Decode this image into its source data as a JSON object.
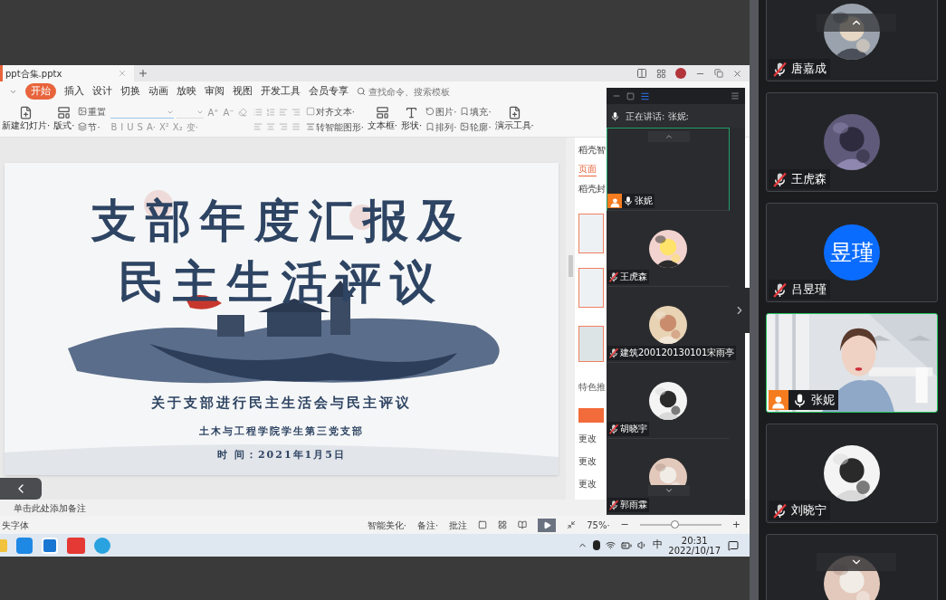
{
  "presentation": {
    "file_tab": "ppt合集.pptx",
    "menu": [
      {
        "label": "开始",
        "selected": true
      },
      {
        "label": "插入",
        "selected": false
      },
      {
        "label": "设计",
        "selected": false
      },
      {
        "label": "切换",
        "selected": false
      },
      {
        "label": "动画",
        "selected": false
      },
      {
        "label": "放映",
        "selected": false
      },
      {
        "label": "审阅",
        "selected": false
      },
      {
        "label": "视图",
        "selected": false
      },
      {
        "label": "开发工具",
        "selected": false
      },
      {
        "label": "会员专享",
        "selected": false
      }
    ],
    "search_placeholder": "查找命令、搜索模板",
    "toolbar": [
      {
        "kind": "large",
        "label": "新建幻灯片·"
      },
      {
        "kind": "large",
        "label": "版式·"
      },
      {
        "kind": "stack",
        "items": [
          "重置",
          "节·"
        ]
      },
      {
        "kind": "font",
        "items": [
          "A⁺",
          "A⁻"
        ],
        "keys": [
          "B",
          "I",
          "U",
          "S",
          "A·",
          "X²",
          "X₂",
          "变·"
        ]
      },
      {
        "kind": "paragraph"
      },
      {
        "kind": "stack",
        "items": [
          "对齐文本·",
          "转智能图形·"
        ]
      },
      {
        "kind": "large",
        "label": "文本框·"
      },
      {
        "kind": "large",
        "label": "形状·"
      },
      {
        "kind": "stack",
        "items": [
          "图片·",
          "排列·"
        ]
      },
      {
        "kind": "stack",
        "items": [
          "填充·",
          "轮廓·"
        ]
      },
      {
        "kind": "large",
        "label": "演示工具·"
      }
    ],
    "slide": {
      "title_lines": [
        "支部年度汇报及",
        "民主生活评议"
      ],
      "subtitle": "关于支部进行民主生活会与民主评议",
      "organization": "土木与工程学院学生第三党支部",
      "date": "时 间：2021年1月5日"
    },
    "side_panel": {
      "header": "稻壳智",
      "tab": "页面",
      "section": "稻壳封",
      "recommend": "特色推",
      "rows": [
        "更改",
        "更改",
        "更改"
      ]
    },
    "notes_placeholder": "单击此处添加备注",
    "status_left": "失字体",
    "status_items": [
      "智能美化·",
      "备注·",
      "批注"
    ],
    "zoom": "75%·",
    "zoom_slider": {
      "level": 0.42
    },
    "zoom_out": "−",
    "zoom_in": "+"
  },
  "taskbar": {
    "ime": "中",
    "time": "20:31",
    "date": "2022/10/17"
  },
  "meeting_panel": {
    "speaking_label": "正在讲话: 张妮:",
    "participants": [
      {
        "name": "张妮",
        "muted": false,
        "speaking": true,
        "host": true,
        "avatar": {
          "kind": "none"
        }
      },
      {
        "name": "王虎森",
        "muted": true,
        "speaking": false,
        "host": false
      },
      {
        "name": "建筑200120130101宋雨亭",
        "muted": true,
        "speaking": false,
        "host": false
      },
      {
        "name": "胡晓宇",
        "muted": true,
        "speaking": false,
        "host": false
      },
      {
        "name": "郭雨霖",
        "muted": true,
        "speaking": false,
        "host": false
      }
    ]
  },
  "gallery": [
    {
      "name": "唐嘉成",
      "muted": true,
      "speaking": false,
      "host": false
    },
    {
      "name": "王虎森",
      "muted": true,
      "speaking": false,
      "host": false
    },
    {
      "name": "吕昱瑾",
      "muted": true,
      "speaking": false,
      "host": false,
      "avatar": {
        "kind": "initials",
        "text": "昱瑾"
      }
    },
    {
      "name": "张妮",
      "muted": false,
      "speaking": true,
      "host": true,
      "avatar": {
        "kind": "video"
      }
    },
    {
      "name": "刘晓宁",
      "muted": true,
      "speaking": false,
      "host": false
    },
    {
      "speaking": false
    }
  ]
}
